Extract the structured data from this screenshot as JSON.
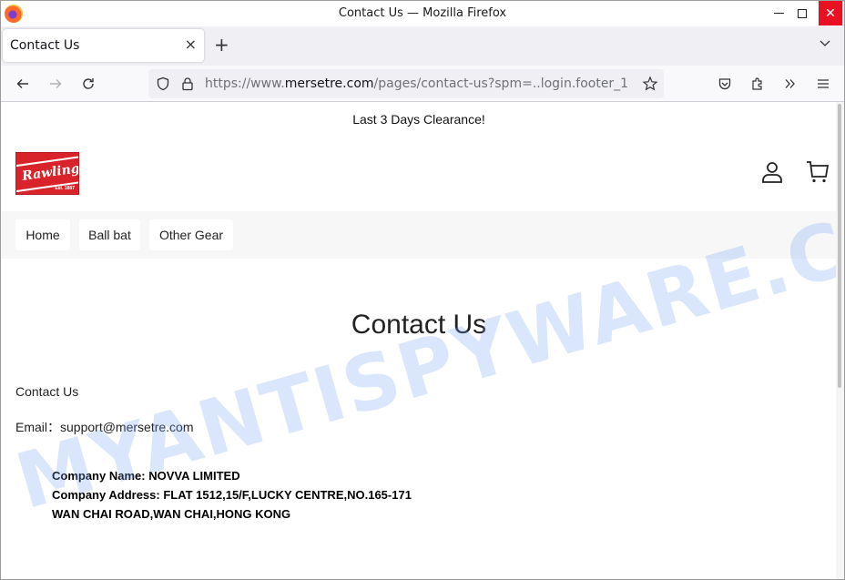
{
  "window": {
    "title": "Contact Us — Mozilla Firefox",
    "controls": {
      "minimize": "minimize",
      "maximize": "maximize",
      "close": "close"
    },
    "close_color": "#e81123"
  },
  "tabs": [
    {
      "title": "Contact Us",
      "active": true
    }
  ],
  "toolbar": {
    "new_tab_glyph": "+",
    "close_tab_glyph": "×",
    "url_prefix": "https://www.",
    "url_domain": "mersetre.com",
    "url_path": "/pages/contact-us?spm=..login.footer_1",
    "icons": [
      "back-icon",
      "forward-icon",
      "reload-icon",
      "shield-icon",
      "lock-icon",
      "bookmark-star-icon",
      "pocket-icon",
      "extensions-icon",
      "overflow-icon",
      "menu-icon"
    ]
  },
  "site": {
    "announcement": "Last 3 Days Clearance!",
    "logo": {
      "text": "Rawlings",
      "est": "Est. 1887",
      "brand_color": "#d8232a"
    },
    "nav": [
      {
        "label": "Home"
      },
      {
        "label": "Ball bat"
      },
      {
        "label": "Other Gear"
      }
    ],
    "page_title": "Contact Us",
    "contact_label": "Contact Us",
    "email_label": "Email：",
    "email_value": "support@mersetre.com",
    "company": {
      "name_line": "Company Name: NOVVA LIMITED",
      "address_line1": "Company Address: FLAT 1512,15/F,LUCKY CENTRE,NO.165-171",
      "address_line2": "WAN CHAI ROAD,WAN CHAI,HONG KONG"
    }
  },
  "watermark": "MYANTISPYWARE.COM"
}
